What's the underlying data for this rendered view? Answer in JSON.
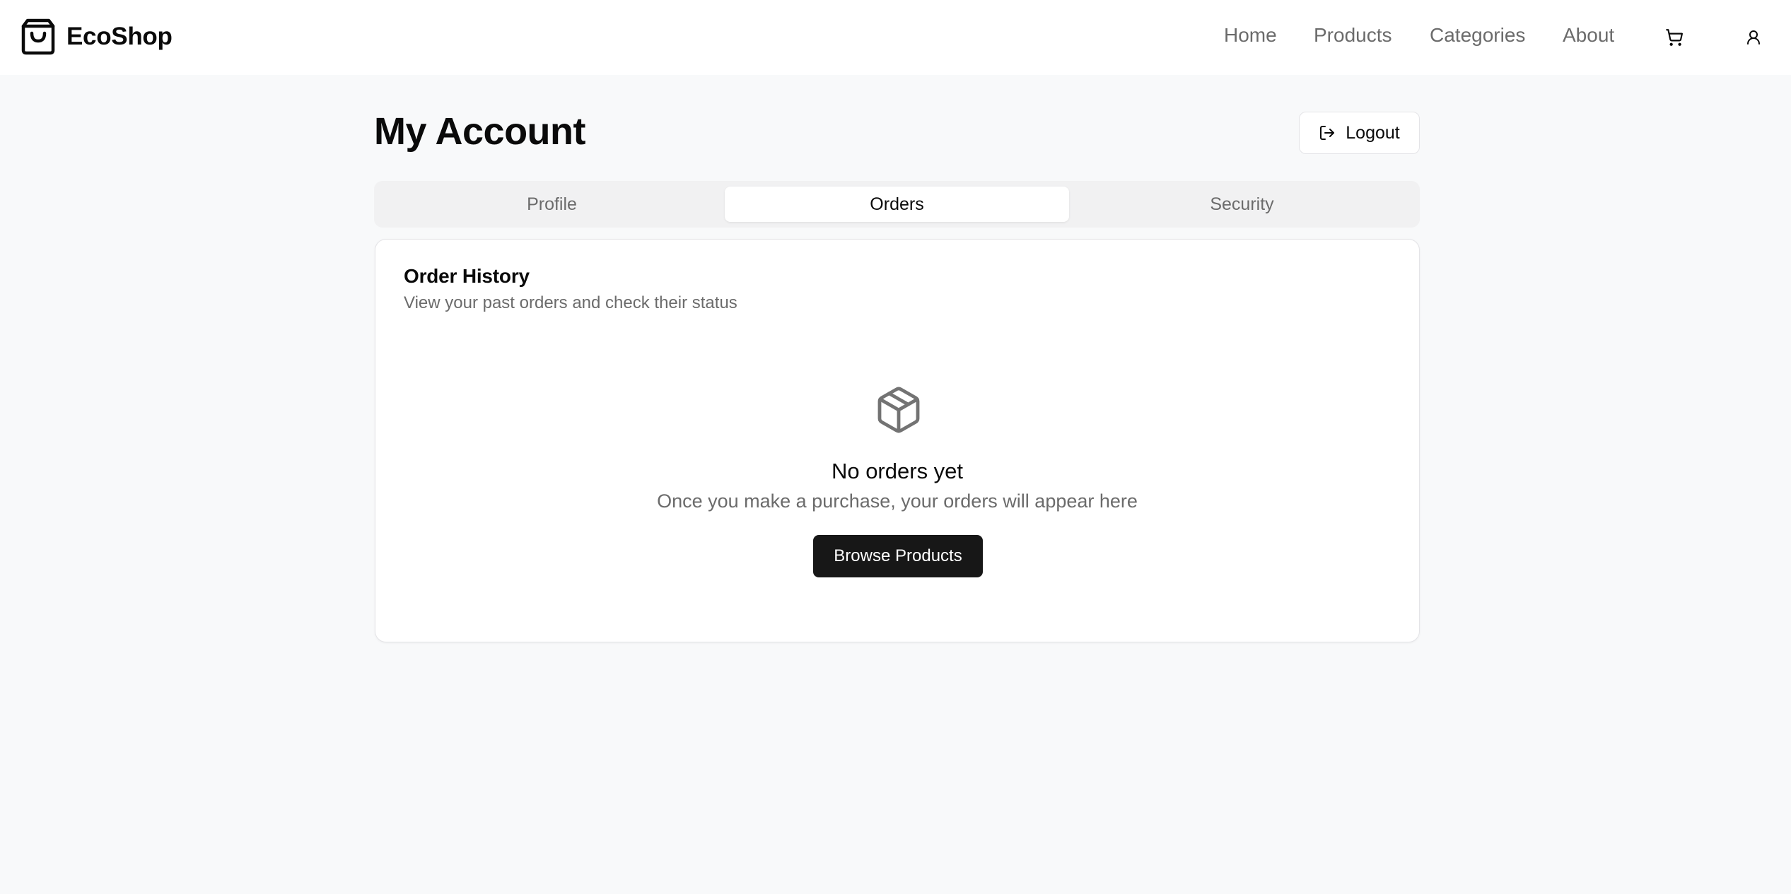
{
  "header": {
    "brand_name": "EcoShop",
    "brand_icon": "shopping-bag-icon",
    "nav": [
      {
        "label": "Home"
      },
      {
        "label": "Products"
      },
      {
        "label": "Categories"
      },
      {
        "label": "About"
      }
    ],
    "cart_icon": "cart-icon",
    "user_icon": "user-icon"
  },
  "page": {
    "title": "My Account",
    "logout_label": "Logout",
    "logout_icon": "logout-icon"
  },
  "tabs": [
    {
      "label": "Profile",
      "active": false
    },
    {
      "label": "Orders",
      "active": true
    },
    {
      "label": "Security",
      "active": false
    }
  ],
  "order_history": {
    "title": "Order History",
    "subtitle": "View your past orders and check their status",
    "empty_icon": "package-icon",
    "empty_title": "No orders yet",
    "empty_text": "Once you make a purchase, your orders will appear here",
    "browse_label": "Browse Products"
  },
  "colors": {
    "background": "#f8f9fa",
    "primary_button": "#171717",
    "muted_text": "#6b6b6b",
    "border": "#e4e4e7"
  }
}
